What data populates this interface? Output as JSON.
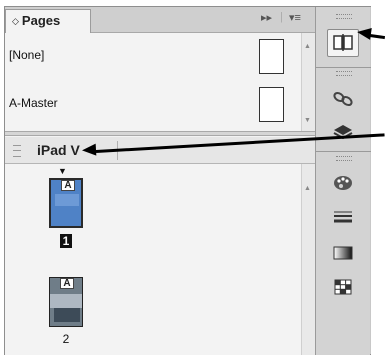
{
  "panel": {
    "tab_label": "Pages",
    "tab_arrows": "◇",
    "fastforward_icon": "▸▸",
    "menu_icon": "▾≡"
  },
  "masters": [
    {
      "label": "[None]"
    },
    {
      "label": "A-Master"
    }
  ],
  "section": {
    "title": "iPad V"
  },
  "pages": [
    {
      "number": "1",
      "master_tag": "A",
      "selected": true
    },
    {
      "number": "2",
      "master_tag": "A",
      "selected": false
    }
  ],
  "rail": {
    "items": [
      {
        "name": "pages-icon"
      },
      {
        "name": "links-icon"
      },
      {
        "name": "layers-icon"
      },
      {
        "name": "swatches-icon"
      },
      {
        "name": "stroke-icon"
      },
      {
        "name": "gradient-icon"
      },
      {
        "name": "swatch-grid-icon"
      }
    ]
  }
}
